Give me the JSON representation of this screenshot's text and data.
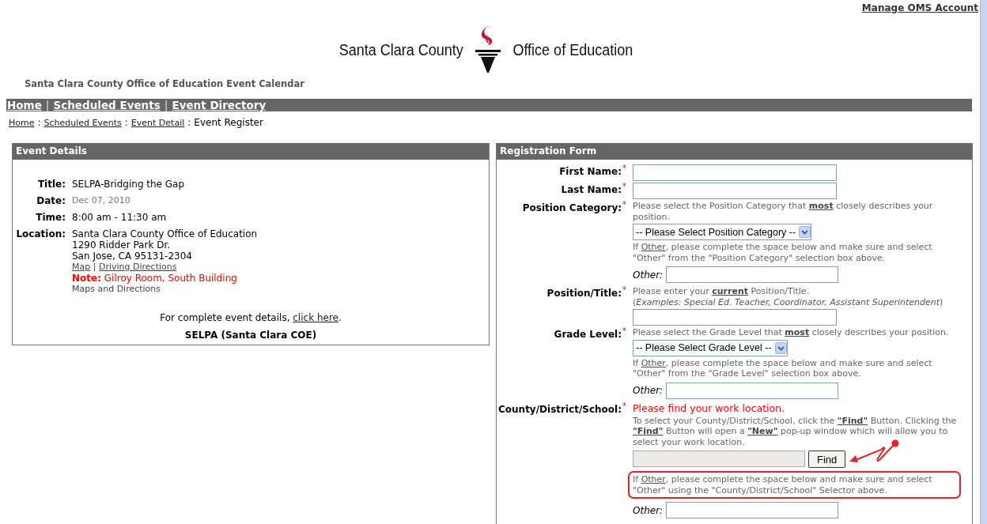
{
  "account_link": "Manage OMS Account",
  "logo": {
    "left_text": "Santa Clara County",
    "right_text": "Office of Education"
  },
  "site_title": "Santa Clara County Office of Education Event Calendar",
  "nav": [
    {
      "label": "Home"
    },
    {
      "separator": "|",
      "label": "Scheduled Events"
    },
    {
      "separator": "|",
      "label": "Event Directory"
    }
  ],
  "breadcrumb": {
    "links": [
      {
        "label": "Home"
      },
      {
        "separator": ":",
        "label": "Scheduled Events"
      },
      {
        "separator": ":",
        "label": "Event Detail"
      }
    ],
    "separator": ":",
    "current": "Event Register"
  },
  "event_details": {
    "title": "Event Details",
    "fields": [
      {
        "label": "Title:",
        "value": "SELPA-Bridging the Gap"
      },
      {
        "label": "Date:",
        "value": "Dec 07, 2010",
        "muted": true
      },
      {
        "label": "Time:",
        "value": "8:00 am - 11:30 am"
      },
      {
        "label": "Location:",
        "lines": [
          "Santa Clara County Office of Education",
          "1290 Ridder Park Dr.",
          "San Jose, CA 95131-2304"
        ],
        "links": [
          {
            "label": "Map"
          },
          {
            "separator": "|",
            "label": "Driving Directions"
          }
        ],
        "note": "**Note:** Gilroy Room, South Building",
        "extra": "Maps and Directions"
      }
    ],
    "more": {
      "pre": "For complete event details, ",
      "link": "click here",
      "post": "."
    },
    "organizer": "SELPA (Santa Clara COE)"
  },
  "registration": {
    "title": "Registration Form",
    "fields": [
      {
        "label": "First Name:",
        "mark": "*",
        "items": [
          {
            "kind": "input"
          }
        ]
      },
      {
        "label": "Last Name:",
        "mark": "*",
        "items": [
          {
            "kind": "input"
          }
        ]
      },
      {
        "label": "Position Category:",
        "mark": "*",
        "items": [
          {
            "kind": "hint",
            "text": "Please select the Position Category that **most** closely describes your position."
          },
          {
            "kind": "select",
            "value": "-- Please Select Position Category --"
          },
          {
            "kind": "link_hint",
            "pre": "If ",
            "link": "Other",
            "post": ", please complete the space below and make sure and select \"Other\" from the \"Position Category\" selection box above.",
            "highlighted": false
          },
          {
            "kind": "other",
            "label": "Other:"
          }
        ]
      },
      {
        "label": "Position/Title:",
        "mark": "*",
        "items": [
          {
            "kind": "hint",
            "text": "Please enter your **current** Position/Title."
          },
          {
            "kind": "hint",
            "text": "(*Examples: Special Ed. Teacher, Coordinator, Assistant Superintendent*)"
          },
          {
            "kind": "input"
          }
        ]
      },
      {
        "label": "Grade Level:",
        "mark": "*",
        "items": [
          {
            "kind": "hint",
            "text": "Please select the Grade Level that **most** closely describes your position."
          },
          {
            "kind": "select",
            "value": "-- Please Select Grade Level --"
          },
          {
            "kind": "link_hint",
            "pre": "If ",
            "link": "Other",
            "post": ", please complete the space below and make sure and select \"Other\" from the \"Grade Level\" selection box above.",
            "highlighted": false
          },
          {
            "kind": "other",
            "label": "Other:"
          }
        ]
      },
      {
        "label": "County/District/School:",
        "mark": "*",
        "items": [
          {
            "kind": "alert",
            "text": "Please find your work location."
          },
          {
            "kind": "hint",
            "text": "To select your County/District/School, click the **\"Find\"** Button. Clicking the **\"Find\"** Button will open a **\"New\"** pop-up window which will allow you to select your work location."
          },
          {
            "kind": "finder",
            "button": "Find",
            "annotated": true
          },
          {
            "kind": "link_hint",
            "pre": "If ",
            "link": "Other",
            "post": ", please complete the space below and make sure and select \"Other\" using the \"County/District/School\" Selector above.",
            "highlighted": true
          },
          {
            "kind": "other",
            "label": "Other:"
          }
        ]
      }
    ]
  }
}
